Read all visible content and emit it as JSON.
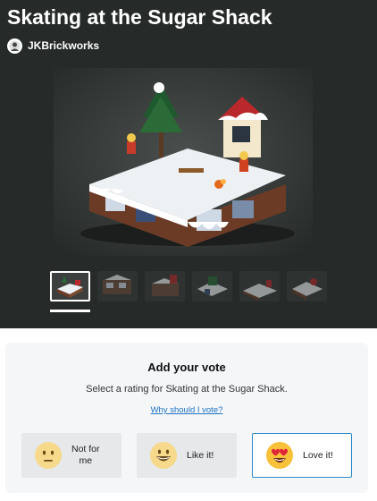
{
  "project": {
    "title": "Skating at the Sugar Shack",
    "author": "JKBrickworks"
  },
  "gallery": {
    "thumbnail_count": 6,
    "active_index": 0
  },
  "vote": {
    "heading": "Add your vote",
    "subtitle": "Select a rating for Skating at the Sugar Shack.",
    "why_link": "Why should I vote?",
    "options": [
      {
        "label": "Not for\nme",
        "icon": "neutral-face-icon"
      },
      {
        "label": "Like it!",
        "icon": "grinning-face-icon"
      },
      {
        "label": "Love it!",
        "icon": "heart-eyes-face-icon",
        "selected": true
      }
    ]
  },
  "colors": {
    "hero_background": "#262b29",
    "accent_link": "#1f73c2",
    "selected_border": "#2a88c8"
  }
}
